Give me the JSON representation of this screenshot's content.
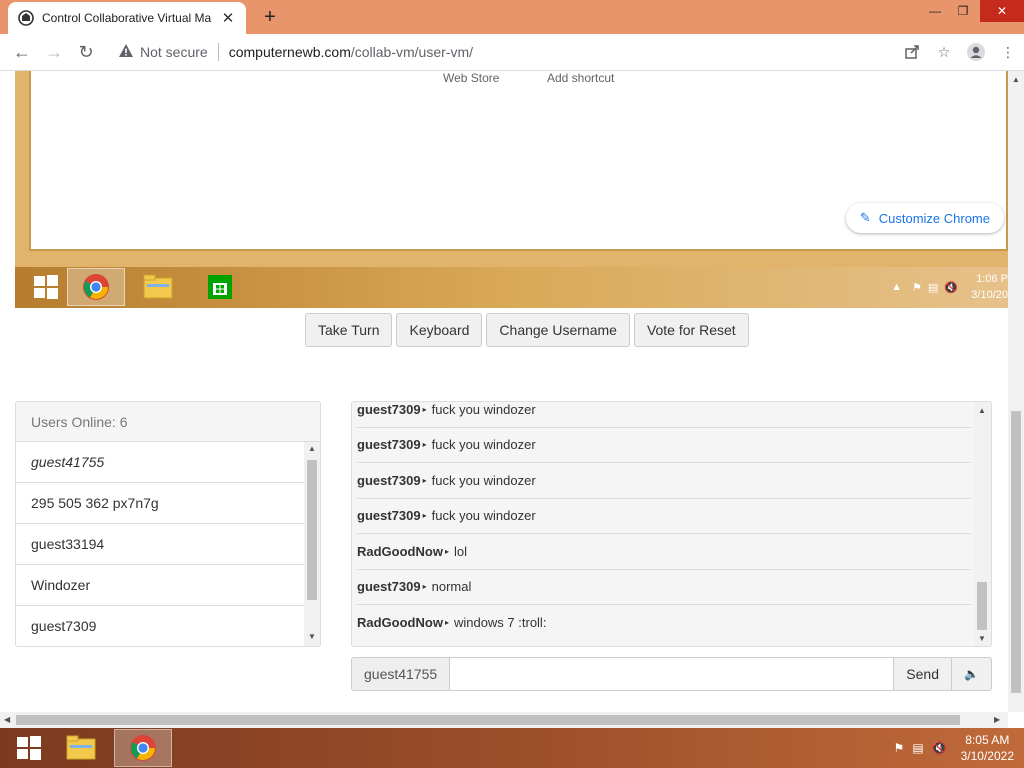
{
  "browser": {
    "tab_title": "Control Collaborative Virtual Ma",
    "security_label": "Not secure",
    "url_host": "computernewb.com",
    "url_path": "/collab-vm/user-vm/"
  },
  "vm_screen": {
    "web_store_label": "Web Store",
    "add_shortcut_label": "Add shortcut",
    "customize_label": "Customize Chrome",
    "clock_time": "1:06 P",
    "clock_date": "3/10/20"
  },
  "controls": {
    "take_turn": "Take Turn",
    "keyboard": "Keyboard",
    "change_username": "Change Username",
    "vote_reset": "Vote for Reset"
  },
  "users": {
    "header": "Users Online: 6",
    "list": [
      {
        "name": "guest41755"
      },
      {
        "name": "295 505 362 px7n7g"
      },
      {
        "name": "guest33194"
      },
      {
        "name": "Windozer"
      },
      {
        "name": "guest7309"
      }
    ]
  },
  "chat": {
    "messages": [
      {
        "user": "guest7309",
        "text": "fuck you windozer"
      },
      {
        "user": "guest7309",
        "text": "fuck you windozer"
      },
      {
        "user": "guest7309",
        "text": "fuck you windozer"
      },
      {
        "user": "guest7309",
        "text": "fuck you windozer"
      },
      {
        "user": "RadGoodNow",
        "text": "lol"
      },
      {
        "user": "guest7309",
        "text": "normal"
      },
      {
        "user": "RadGoodNow",
        "text": "windows 7 :troll:"
      }
    ],
    "username_label": "guest41755",
    "input_value": "",
    "send_label": "Send"
  },
  "host_taskbar": {
    "clock_time": "8:05 AM",
    "clock_date": "3/10/2022"
  }
}
